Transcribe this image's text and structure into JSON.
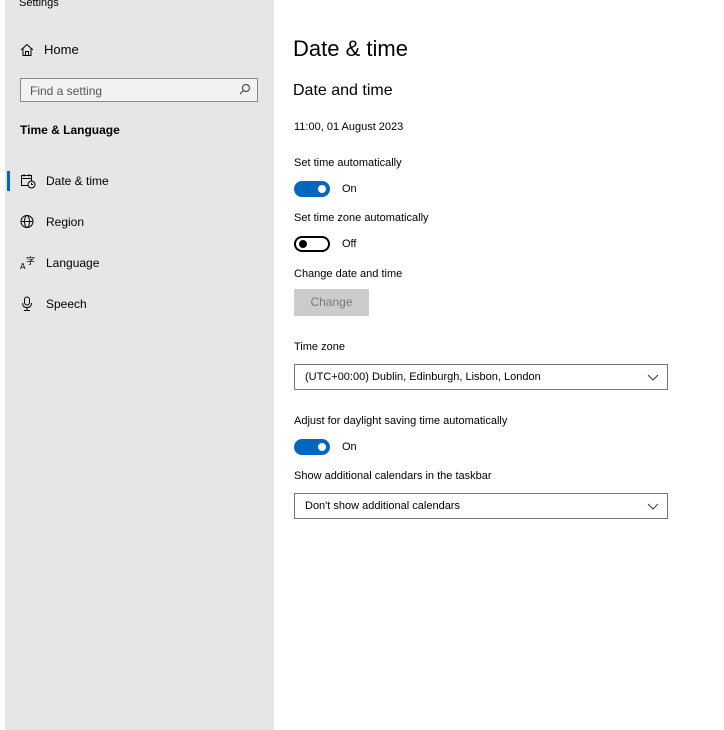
{
  "app": {
    "title": "Settings"
  },
  "sidebar": {
    "home_label": "Home",
    "search_placeholder": "Find a setting",
    "section_title": "Time & Language",
    "items": [
      {
        "label": "Date & time",
        "icon": "calendar-clock-icon",
        "active": true
      },
      {
        "label": "Region",
        "icon": "globe-icon",
        "active": false
      },
      {
        "label": "Language",
        "icon": "language-icon",
        "active": false
      },
      {
        "label": "Speech",
        "icon": "microphone-icon",
        "active": false
      }
    ]
  },
  "main": {
    "title": "Date & time",
    "subtitle": "Date and time",
    "current_datetime": "11:00, 01 August 2023",
    "set_time_auto": {
      "label": "Set time automatically",
      "state": "On"
    },
    "set_tz_auto": {
      "label": "Set time zone automatically",
      "state": "Off"
    },
    "change_datetime": {
      "label": "Change date and time",
      "button": "Change"
    },
    "time_zone": {
      "label": "Time zone",
      "value": "(UTC+00:00) Dublin, Edinburgh, Lisbon, London"
    },
    "dst": {
      "label": "Adjust for daylight saving time automatically",
      "state": "On"
    },
    "calendars": {
      "label": "Show additional calendars in the taskbar",
      "value": "Don't show additional calendars"
    }
  },
  "colors": {
    "accent": "#0067c0",
    "sidebar_bg": "#e6e6e6",
    "disabled_button": "#cccccc"
  }
}
